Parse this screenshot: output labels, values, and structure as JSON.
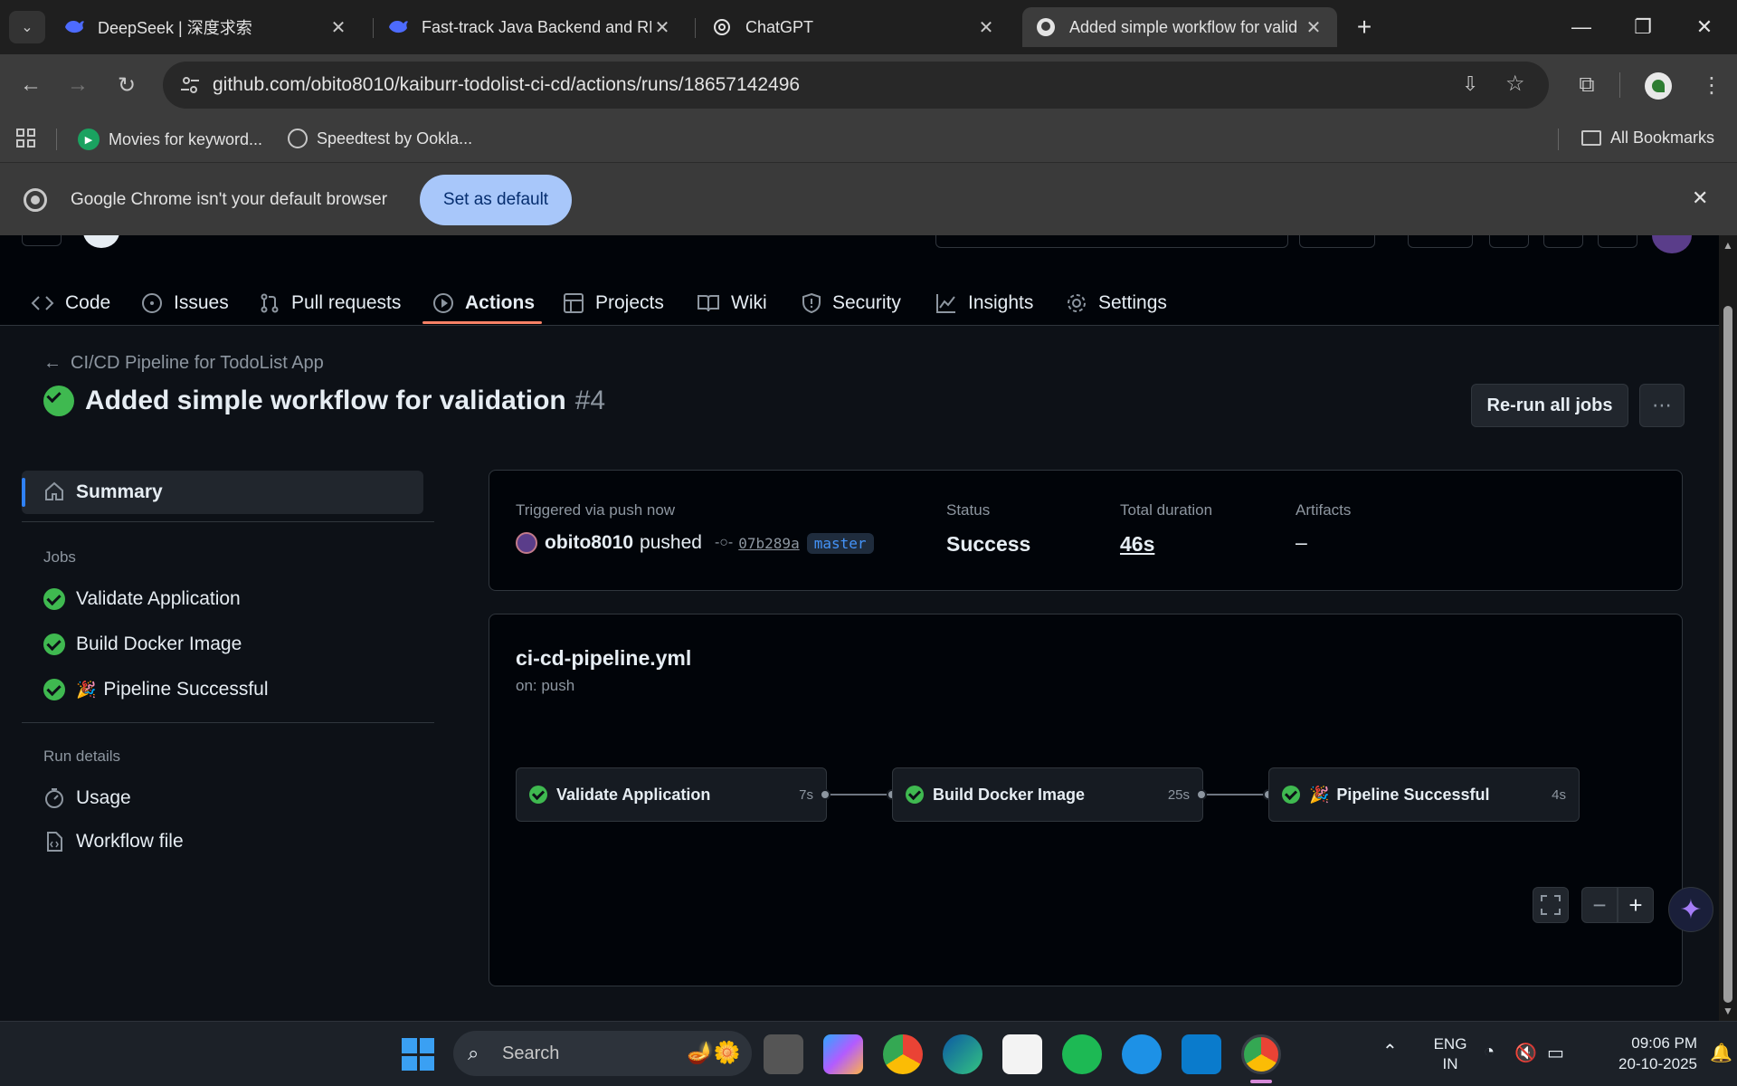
{
  "browser": {
    "tabs": [
      {
        "title": "DeepSeek | 深度求索",
        "icon": "deepseek-whale-icon"
      },
      {
        "title": "Fast-track Java Backend and RE",
        "icon": "deepseek-whale-icon"
      },
      {
        "title": "ChatGPT",
        "icon": "chatgpt-icon"
      },
      {
        "title": "Added simple workflow for valid",
        "icon": "github-icon"
      }
    ],
    "url": "github.com/obito8010/kaiburr-todolist-ci-cd/actions/runs/18657142496",
    "bookmarks": [
      "Movies for keyword...",
      "Speedtest by Ookla..."
    ],
    "all_bookmarks_label": "All Bookmarks",
    "infobar": {
      "message": "Google Chrome isn't your default browser",
      "button": "Set as default"
    }
  },
  "repo_nav": {
    "items": [
      "Code",
      "Issues",
      "Pull requests",
      "Actions",
      "Projects",
      "Wiki",
      "Security",
      "Insights",
      "Settings"
    ],
    "active": "Actions"
  },
  "run": {
    "breadcrumb": "CI/CD Pipeline for TodoList App",
    "title": "Added simple workflow for validation",
    "number": "#4",
    "rerun_label": "Re-run all jobs"
  },
  "sidebar": {
    "summary_label": "Summary",
    "jobs_heading": "Jobs",
    "jobs": [
      "Validate Application",
      "Build Docker Image",
      "Pipeline Successful"
    ],
    "pipeline_emoji": "🎉",
    "run_details_heading": "Run details",
    "usage_label": "Usage",
    "workflow_file_label": "Workflow file"
  },
  "summary": {
    "triggered_label": "Triggered via push now",
    "user": "obito8010",
    "action": "pushed",
    "commit": "07b289a",
    "branch": "master",
    "status_label": "Status",
    "status_value": "Success",
    "duration_label": "Total duration",
    "duration_value": "46s",
    "artifacts_label": "Artifacts",
    "artifacts_value": "–"
  },
  "workflow": {
    "file": "ci-cd-pipeline.yml",
    "trigger": "on: push",
    "jobs": [
      {
        "name": "Validate Application",
        "duration": "7s",
        "emoji": ""
      },
      {
        "name": "Build Docker Image",
        "duration": "25s",
        "emoji": ""
      },
      {
        "name": "Pipeline Successful",
        "duration": "4s",
        "emoji": "🎉"
      }
    ]
  },
  "taskbar": {
    "search_placeholder": "Search",
    "lang_line1": "ENG",
    "lang_line2": "IN",
    "time": "09:06 PM",
    "date": "20-10-2025"
  },
  "colors": {
    "success": "#3fb950",
    "accent_underline": "#f78166",
    "link_blue": "#2f81f7"
  }
}
